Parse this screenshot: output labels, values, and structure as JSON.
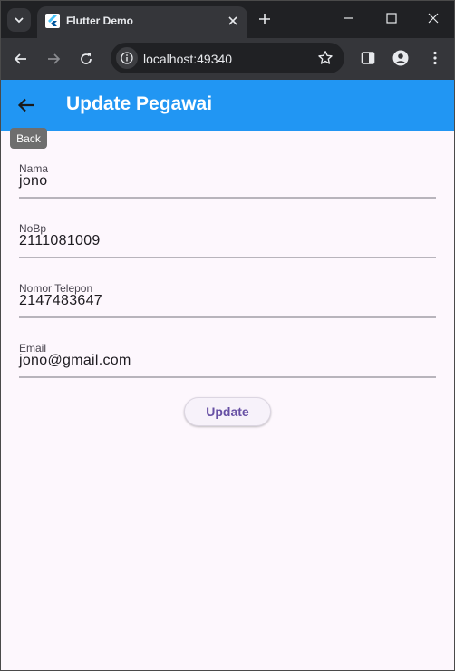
{
  "browser": {
    "tab_title": "Flutter Demo",
    "url": "localhost:49340"
  },
  "app": {
    "title": "Update Pegawai",
    "back_tooltip": "Back",
    "fields": [
      {
        "label": "Nama",
        "value": "jono"
      },
      {
        "label": "NoBp",
        "value": "2111081009"
      },
      {
        "label": "Nomor Telepon",
        "value": "2147483647"
      },
      {
        "label": "Email",
        "value": "jono@gmail.com"
      }
    ],
    "update_label": "Update"
  },
  "colors": {
    "appbar": "#2196f3",
    "background": "#fdf7fd",
    "button_text": "#6750a4",
    "chrome_dark": "#202124",
    "chrome_toolbar": "#35363a"
  }
}
